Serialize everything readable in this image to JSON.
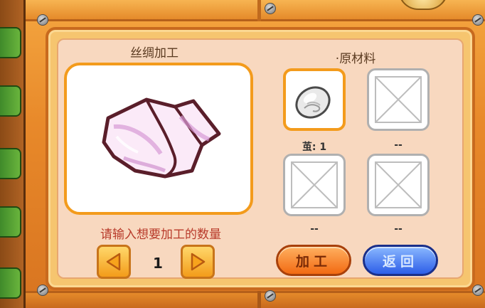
{
  "product_panel": {
    "title": "丝绸加工",
    "product_icon": "silk-cloth-icon"
  },
  "quantity": {
    "prompt": "请输入想要加工的数量",
    "value": "1",
    "decrease_icon": "left-arrow-icon",
    "increase_icon": "right-arrow-icon"
  },
  "materials": {
    "title": "·原材料",
    "slots": [
      {
        "label": "茧: 1",
        "icon": "cocoon-icon",
        "filled": true
      },
      {
        "label": "--",
        "icon": "empty-slot-icon",
        "filled": false
      },
      {
        "label": "--",
        "icon": "empty-slot-icon",
        "filled": false
      },
      {
        "label": "--",
        "icon": "empty-slot-icon",
        "filled": false
      }
    ]
  },
  "buttons": {
    "process": "加工",
    "back": "返回"
  },
  "colors": {
    "frame_orange": "#f39b1c",
    "panel_bg": "#f8d8bf",
    "prompt_red": "#b83a2a",
    "process_button": "#f26a12",
    "back_button": "#2d5ee8"
  }
}
